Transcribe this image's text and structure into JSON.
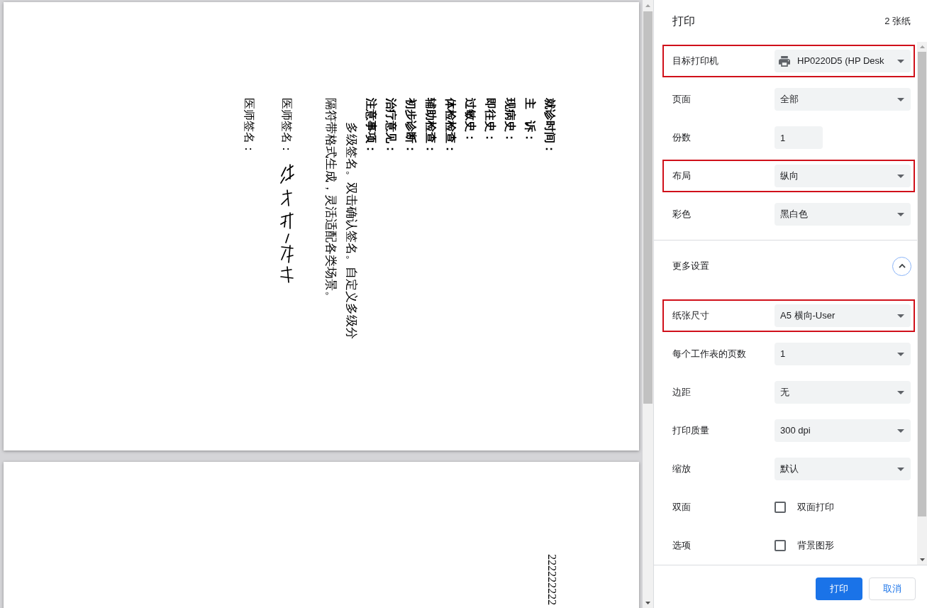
{
  "preview": {
    "pages": [
      {
        "kind": "record",
        "fields": [
          "就诊时间：",
          "主　诉：",
          "现病史：",
          "即往史：",
          "过敏史：",
          "体检检查：",
          "辅助检查：",
          "初步诊断：",
          "治疗意见：",
          "注意事项："
        ],
        "paragraph": "多级签名。双击确认签名。自定义多级分隔符带格式生成，灵活适配各类场景。",
        "signatures": [
          {
            "label": "医师签名：",
            "signed": true
          },
          {
            "label": "医师签名：",
            "signed": false
          }
        ]
      },
      {
        "kind": "text",
        "text": "222222222"
      }
    ]
  },
  "print_panel": {
    "title": "打印",
    "sheet_count": "2 张纸",
    "settings": [
      {
        "kind": "printer",
        "label": "目标打印机",
        "value": "HP0220D5 (HP Desk",
        "highlighted": true
      },
      {
        "kind": "select",
        "label": "页面",
        "value": "全部",
        "highlighted": false
      },
      {
        "kind": "number",
        "label": "份数",
        "value": "1",
        "highlighted": false
      },
      {
        "kind": "select",
        "label": "布局",
        "value": "纵向",
        "highlighted": true
      },
      {
        "kind": "select",
        "label": "彩色",
        "value": "黑白色",
        "highlighted": false
      }
    ],
    "more_settings": {
      "label": "更多设置",
      "expanded": true
    },
    "advanced_settings": [
      {
        "kind": "select",
        "label": "纸张尺寸",
        "value": "A5 横向-User",
        "highlighted": true
      },
      {
        "kind": "select",
        "label": "每个工作表的页数",
        "value": "1",
        "highlighted": false
      },
      {
        "kind": "select",
        "label": "边距",
        "value": "无",
        "highlighted": false
      },
      {
        "kind": "select",
        "label": "打印质量",
        "value": "300 dpi",
        "highlighted": false
      },
      {
        "kind": "select",
        "label": "缩放",
        "value": "默认",
        "highlighted": false
      },
      {
        "kind": "checkbox",
        "label": "双面",
        "value": "双面打印",
        "checked": false,
        "highlighted": false
      },
      {
        "kind": "checkbox",
        "label": "选项",
        "value": "背景图形",
        "checked": false,
        "highlighted": false
      }
    ],
    "buttons": [
      {
        "label": "打印",
        "primary": true
      },
      {
        "label": "取消",
        "primary": false
      }
    ]
  }
}
